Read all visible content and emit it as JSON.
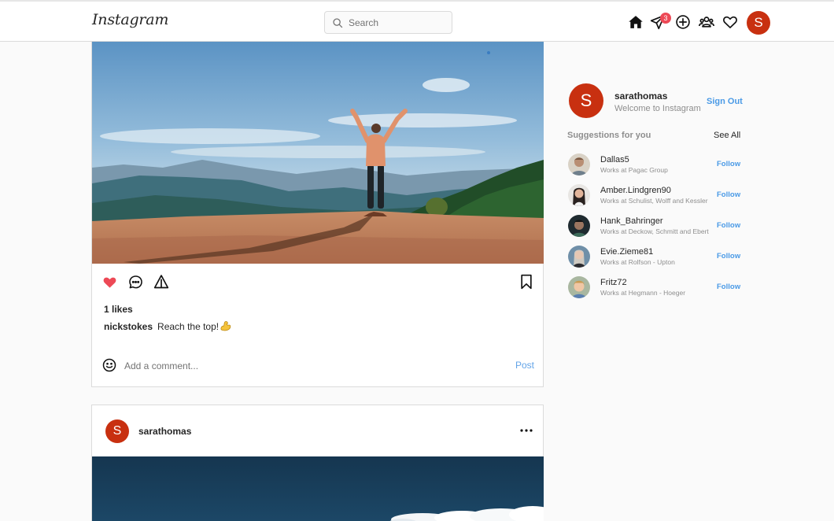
{
  "app": {
    "logo": "Instagram"
  },
  "header": {
    "search_placeholder": "Search",
    "messages_badge": "3",
    "user_initial": "S"
  },
  "post1": {
    "likes": "1 likes",
    "username": "nickstokes",
    "caption": "Reach the top!",
    "caption_emoji": "flexed-biceps",
    "comment_placeholder": "Add a comment...",
    "post_label": "Post",
    "liked": true
  },
  "post2": {
    "user_initial": "S",
    "username": "sarathomas"
  },
  "sidebar": {
    "user_initial": "S",
    "username": "sarathomas",
    "subtitle": "Welcome to Instagram",
    "sign_out": "Sign Out",
    "suggestions_title": "Suggestions for you",
    "see_all": "See All",
    "follow_label": "Follow",
    "suggestions": [
      {
        "name": "Dallas5",
        "work": "Works at Pagac Group"
      },
      {
        "name": "Amber.Lindgren90",
        "work": "Works at Schulist, Wolff and Kessler"
      },
      {
        "name": "Hank_Bahringer",
        "work": "Works at Deckow, Schmitt and Ebert"
      },
      {
        "name": "Evie.Zieme81",
        "work": "Works at Rolfson - Upton"
      },
      {
        "name": "Fritz72",
        "work": "Works at Hegmann - Hoeger"
      }
    ]
  },
  "colors": {
    "accent_link": "#4a9ae6",
    "like_red": "#ed4956",
    "avatar_bg": "#c83010"
  }
}
